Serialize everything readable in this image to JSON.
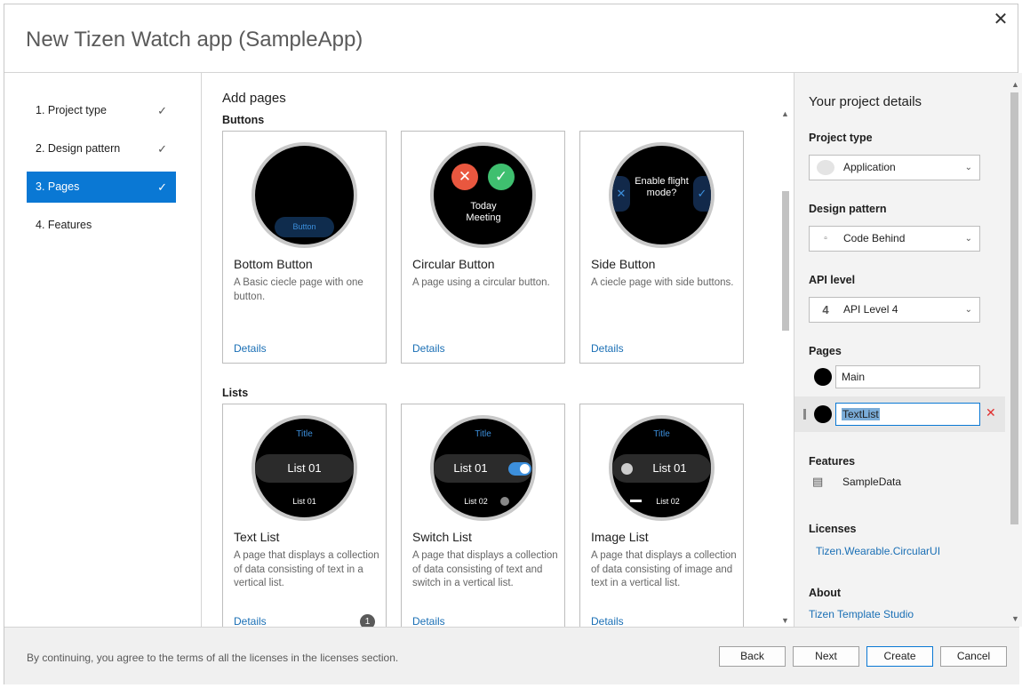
{
  "window": {
    "title": "New Tizen Watch app (SampleApp)",
    "close_glyph": "✕"
  },
  "nav": {
    "items": [
      {
        "label": "1. Project type",
        "completed": true,
        "active": false
      },
      {
        "label": "2. Design pattern",
        "completed": true,
        "active": false
      },
      {
        "label": "3. Pages",
        "completed": true,
        "active": true
      },
      {
        "label": "4. Features",
        "completed": false,
        "active": false
      }
    ],
    "check_glyph": "✓"
  },
  "main": {
    "heading": "Add pages",
    "sections": [
      {
        "label": "Buttons",
        "cards": [
          {
            "title": "Bottom Button",
            "description": "A Basic ciecle page with one button.",
            "details": "Details",
            "preview": {
              "button_label": "Button"
            }
          },
          {
            "title": "Circular Button",
            "description": "A page using a circular button.",
            "details": "Details",
            "preview": {
              "text": "Today Meeting"
            }
          },
          {
            "title": "Side Button",
            "description": "A ciecle page with side buttons.",
            "details": "Details",
            "preview": {
              "text": "Enable flight mode?"
            }
          }
        ]
      },
      {
        "label": "Lists",
        "cards": [
          {
            "title": "Text List",
            "description": "A page that displays a collection of data consisting of text in a vertical list.",
            "details": "Details",
            "badge": "1",
            "preview": {
              "title": "Title",
              "row": "List 01",
              "sub": "List 01"
            }
          },
          {
            "title": "Switch List",
            "description": "A page that displays a collection of data consisting of text and switch in a vertical list.",
            "details": "Details",
            "preview": {
              "title": "Title",
              "row": "List 01",
              "sub": "List 02"
            }
          },
          {
            "title": "Image List",
            "description": "A page that displays a collection of data consisting of image and text in a vertical list.",
            "details": "Details",
            "preview": {
              "title": "Title",
              "row": "List 01",
              "sub": "List 02"
            }
          }
        ]
      }
    ]
  },
  "details_panel": {
    "heading": "Your project details",
    "project_type": {
      "label": "Project type",
      "value": "Application",
      "icon": "application-icon"
    },
    "design_pattern": {
      "label": "Design pattern",
      "value": "Code Behind",
      "icon": "code-behind-icon"
    },
    "api_level": {
      "label": "API level",
      "value": "API Level 4",
      "icon_text": "4"
    },
    "pages": {
      "label": "Pages",
      "items": [
        {
          "name": "Main",
          "selected": false
        },
        {
          "name": "TextList",
          "selected": true
        }
      ],
      "remove_glyph": "✕"
    },
    "features": {
      "label": "Features",
      "items": [
        "SampleData"
      ]
    },
    "licenses": {
      "label": "Licenses",
      "link": "Tizen.Wearable.CircularUI"
    },
    "about": {
      "label": "About",
      "link": "Tizen Template Studio"
    }
  },
  "footer": {
    "notice": "By continuing, you agree to the terms of all the licenses in the licenses section.",
    "buttons": {
      "back": "Back",
      "next": "Next",
      "create": "Create",
      "cancel": "Cancel"
    }
  },
  "colors": {
    "accent": "#0a78d4",
    "link": "#1a6fb5",
    "watch_blue": "#3c8fdc",
    "circle_red": "#e9573f",
    "circle_green": "#3fbf6f",
    "remove_red": "#e03030"
  }
}
